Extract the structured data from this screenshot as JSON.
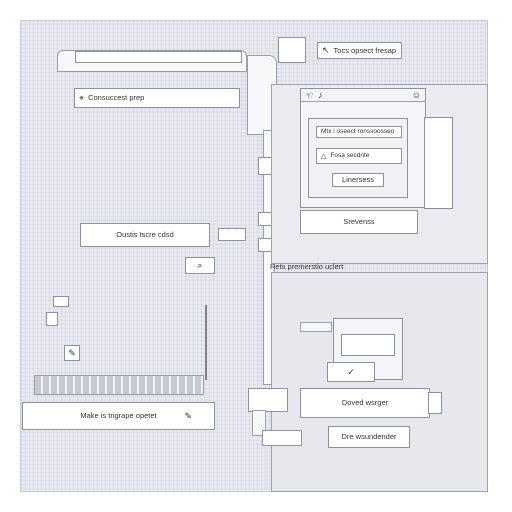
{
  "top_search": {
    "value": "",
    "label": "Consuccest prep",
    "icon": "cursor-icon"
  },
  "top_right_label": {
    "text": "Tocs opsect fresap",
    "icon": "arrow-icon"
  },
  "window": {
    "title_icons": [
      "hand-icon",
      "bell-icon",
      "user-icon"
    ],
    "row1": {
      "text": "Mtx i oseect ronssoosseo"
    },
    "row2": {
      "text": "Fosa secdnte"
    },
    "button": "Linersess",
    "footer": "Srevenss"
  },
  "left_label_1": {
    "text": "Oustis tscre cdsd"
  },
  "search_button": {
    "icon": "search-icon"
  },
  "mid_label": {
    "text": "Rets premerstio uclert"
  },
  "left_label_2": {
    "text": "Make is trigrape opetet",
    "icon": "pencil-icon"
  },
  "right_card": {
    "text": "Doved wsrger"
  },
  "bottom_label": {
    "text": "Dre wsundender"
  },
  "small_tile_icon": "edit-icon",
  "colors": {
    "background": "#e3e5ec",
    "border": "#8d919c",
    "panel": "#eceef3"
  }
}
